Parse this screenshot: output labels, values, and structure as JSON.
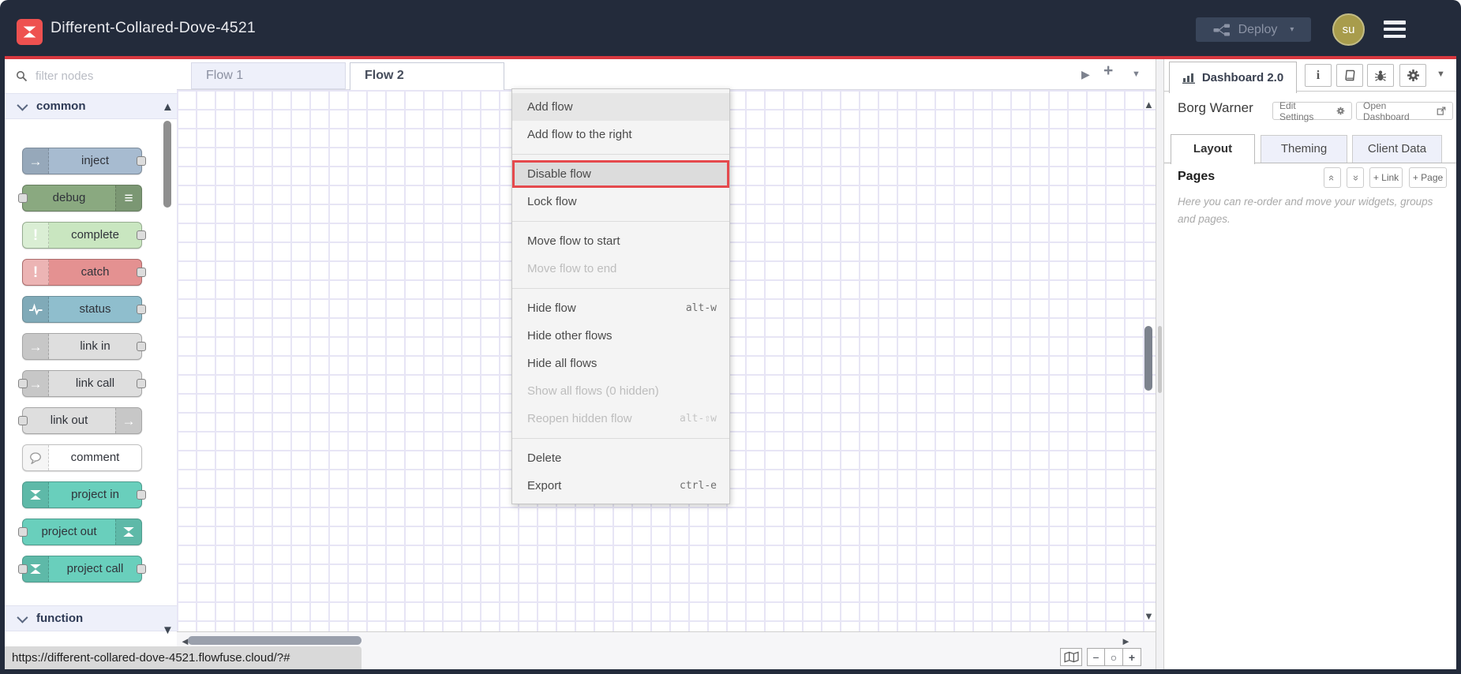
{
  "header": {
    "title": "Different-Collared-Dove-4521",
    "deploy_label": "Deploy",
    "avatar_initials": "su"
  },
  "palette": {
    "filter_placeholder": "filter nodes",
    "category_common": "common",
    "category_function": "function",
    "nodes": [
      {
        "label": "inject"
      },
      {
        "label": "debug"
      },
      {
        "label": "complete"
      },
      {
        "label": "catch"
      },
      {
        "label": "status"
      },
      {
        "label": "link in"
      },
      {
        "label": "link call"
      },
      {
        "label": "link out"
      },
      {
        "label": "comment"
      },
      {
        "label": "project in"
      },
      {
        "label": "project out"
      },
      {
        "label": "project call"
      }
    ]
  },
  "canvas": {
    "tabs": [
      {
        "label": "Flow 1"
      },
      {
        "label": "Flow 2"
      }
    ]
  },
  "context_menu": {
    "items": [
      {
        "label": "Add flow"
      },
      {
        "label": "Add flow to the right"
      },
      {
        "label": "Disable flow",
        "highlighted": true
      },
      {
        "label": "Lock flow"
      },
      {
        "label": "Move flow to start"
      },
      {
        "label": "Move flow to end",
        "disabled": true
      },
      {
        "label": "Hide flow",
        "shortcut": "alt-w"
      },
      {
        "label": "Hide other flows"
      },
      {
        "label": "Hide all flows"
      },
      {
        "label": "Show all flows (0 hidden)",
        "disabled": true
      },
      {
        "label": "Reopen hidden flow",
        "shortcut": "alt-⇧w",
        "disabled": true
      },
      {
        "label": "Delete"
      },
      {
        "label": "Export",
        "shortcut": "ctrl-e"
      }
    ]
  },
  "sidebar": {
    "panel_tab": "Dashboard 2.0",
    "project_name": "Borg Warner",
    "edit_settings_label": "Edit Settings",
    "open_dashboard_label": "Open Dashboard",
    "tabs": [
      {
        "label": "Layout"
      },
      {
        "label": "Theming"
      },
      {
        "label": "Client Data"
      }
    ],
    "pages_title": "Pages",
    "add_link_label": "+ Link",
    "add_page_label": "+ Page",
    "help_text": "Here you can re-order and move your widgets, groups and pages."
  },
  "statusbar": {
    "url": "https://different-collared-dove-4521.flowfuse.cloud/?#",
    "zoom_out": "−",
    "zoom_reset": "○",
    "zoom_in": "+"
  },
  "colors": {
    "header_bg": "#232b3b",
    "accent_red": "#d8383f",
    "highlight_border": "#e5494d",
    "category_bg": "#eef0fa",
    "node_inject": "#a7bbd0",
    "node_debug": "#8aa980",
    "node_complete": "#c9e6c0",
    "node_catch": "#e49191",
    "node_status": "#8fbecd",
    "node_link": "#dedede",
    "node_project": "#69cfbc"
  }
}
